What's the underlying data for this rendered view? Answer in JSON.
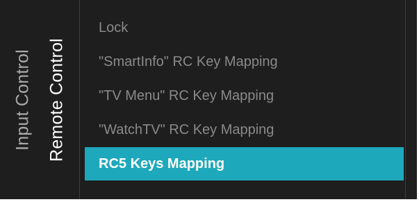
{
  "side_tabs": {
    "input_control": "Input Control",
    "remote_control": "Remote Control"
  },
  "menu": {
    "items": [
      {
        "label": "Lock",
        "selected": false
      },
      {
        "label": "\"SmartInfo\" RC Key Mapping",
        "selected": false
      },
      {
        "label": "\"TV Menu\" RC Key Mapping",
        "selected": false
      },
      {
        "label": "\"WatchTV\" RC Key Mapping",
        "selected": false
      },
      {
        "label": "RC5 Keys Mapping",
        "selected": true
      }
    ]
  },
  "colors": {
    "background": "#1e1e1e",
    "highlight": "#1ea8bc",
    "inactive_text": "#8a8a8a",
    "active_text": "#ffffff"
  }
}
